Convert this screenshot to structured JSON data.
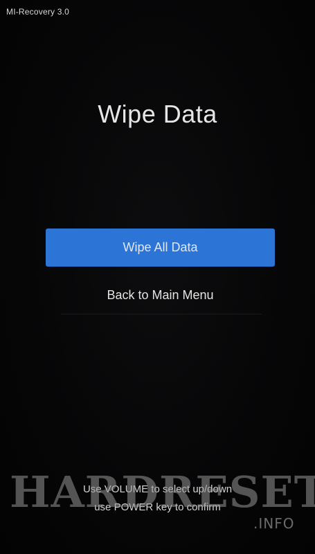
{
  "status_bar": {
    "version": "MI-Recovery 3.0"
  },
  "screen": {
    "title": "Wipe Data"
  },
  "menu": {
    "wipe_all_data": "Wipe All Data",
    "back_to_main_menu": "Back to Main Menu"
  },
  "hints": {
    "line1": "Use VOLUME to select up/down",
    "line2": "use POWER key to confirm"
  },
  "watermark": {
    "brand": "HARDRESET",
    "suffix": ".INFO"
  },
  "colors": {
    "background": "#050505",
    "accent_button": "#2c74d6",
    "text": "#e6e6e6"
  }
}
